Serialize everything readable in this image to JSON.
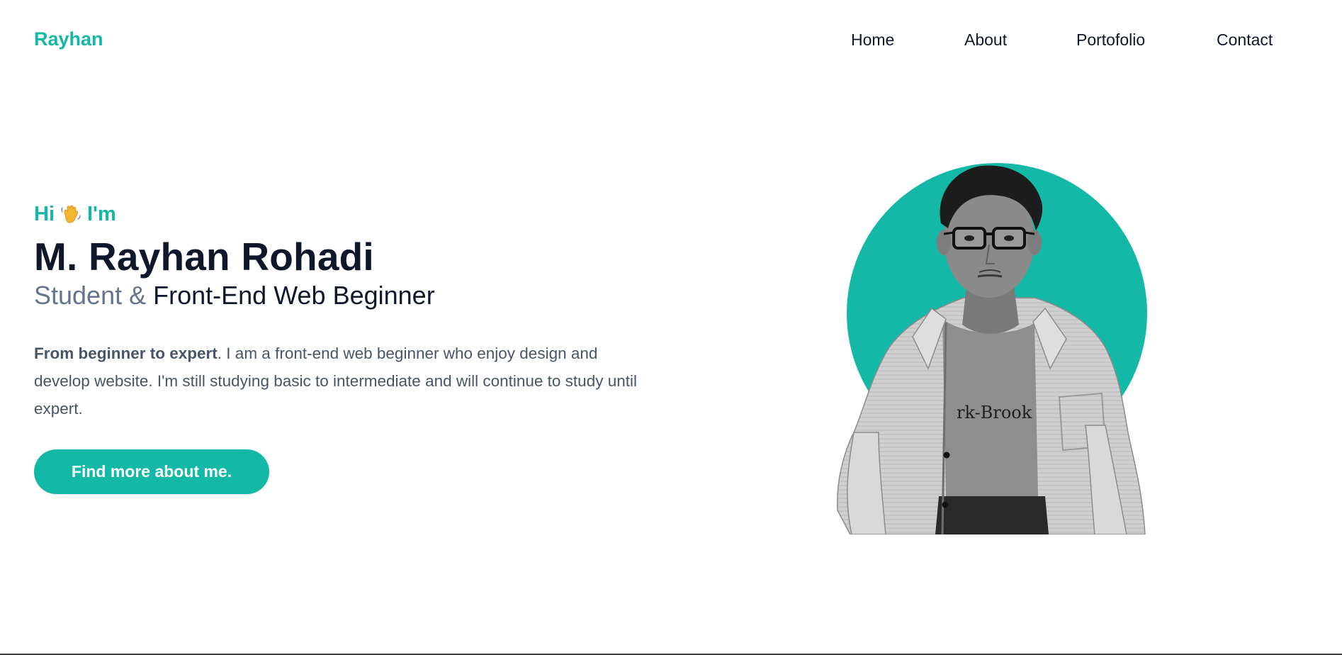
{
  "nav": {
    "brand": "Rayhan",
    "links": [
      {
        "label": "Home"
      },
      {
        "label": "About"
      },
      {
        "label": "Portofolio"
      },
      {
        "label": "Contact"
      }
    ]
  },
  "hero": {
    "greeting_hi": "Hi",
    "greeting_im": "I'm",
    "greeting_icon": "waving-hand-icon",
    "name": "M. Rayhan Rohadi",
    "subtitle_part1": "Student &",
    "subtitle_part2": "Front-End Web Beginner",
    "description_bold": "From beginner to expert",
    "description_rest": ". I am a front-end web beginner who enjoy design and develop website. I'm still studying basic to intermediate and will continue to study until expert.",
    "cta_label": "Find more about me."
  },
  "colors": {
    "accent": "#14b8a6",
    "heading": "#0f172a",
    "muted": "#64748b",
    "body": "#475569"
  }
}
